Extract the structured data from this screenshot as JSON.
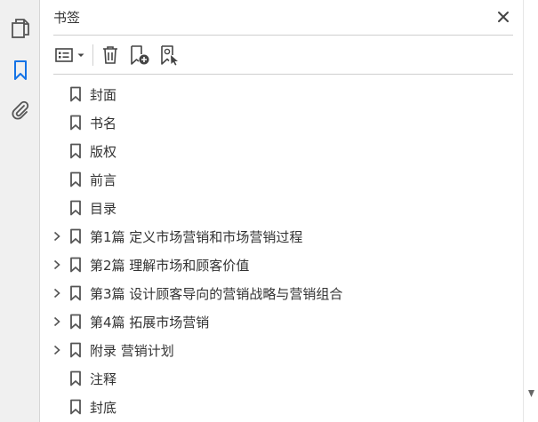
{
  "rail": {
    "icons": [
      "pages-icon",
      "bookmark-icon",
      "attachment-icon"
    ],
    "active_color": "#1473e6"
  },
  "panel": {
    "title": "书签"
  },
  "toolbar": {
    "icons": [
      "options-menu-icon",
      "chevron-down-icon",
      "delete-bookmark-icon",
      "new-bookmark-icon",
      "find-current-bookmark-icon"
    ]
  },
  "bookmarks": [
    {
      "label": "封面",
      "expandable": false
    },
    {
      "label": "书名",
      "expandable": false
    },
    {
      "label": "版权",
      "expandable": false
    },
    {
      "label": "前言",
      "expandable": false
    },
    {
      "label": "目录",
      "expandable": false
    },
    {
      "label": "第1篇  定义市场营销和市场营销过程",
      "expandable": true
    },
    {
      "label": "第2篇  理解市场和顾客价值",
      "expandable": true
    },
    {
      "label": "第3篇  设计顾客导向的营销战略与营销组合",
      "expandable": true
    },
    {
      "label": "第4篇  拓展市场营销",
      "expandable": true
    },
    {
      "label": "附录  营销计划",
      "expandable": true
    },
    {
      "label": "注释",
      "expandable": false
    },
    {
      "label": "封底",
      "expandable": false
    }
  ]
}
